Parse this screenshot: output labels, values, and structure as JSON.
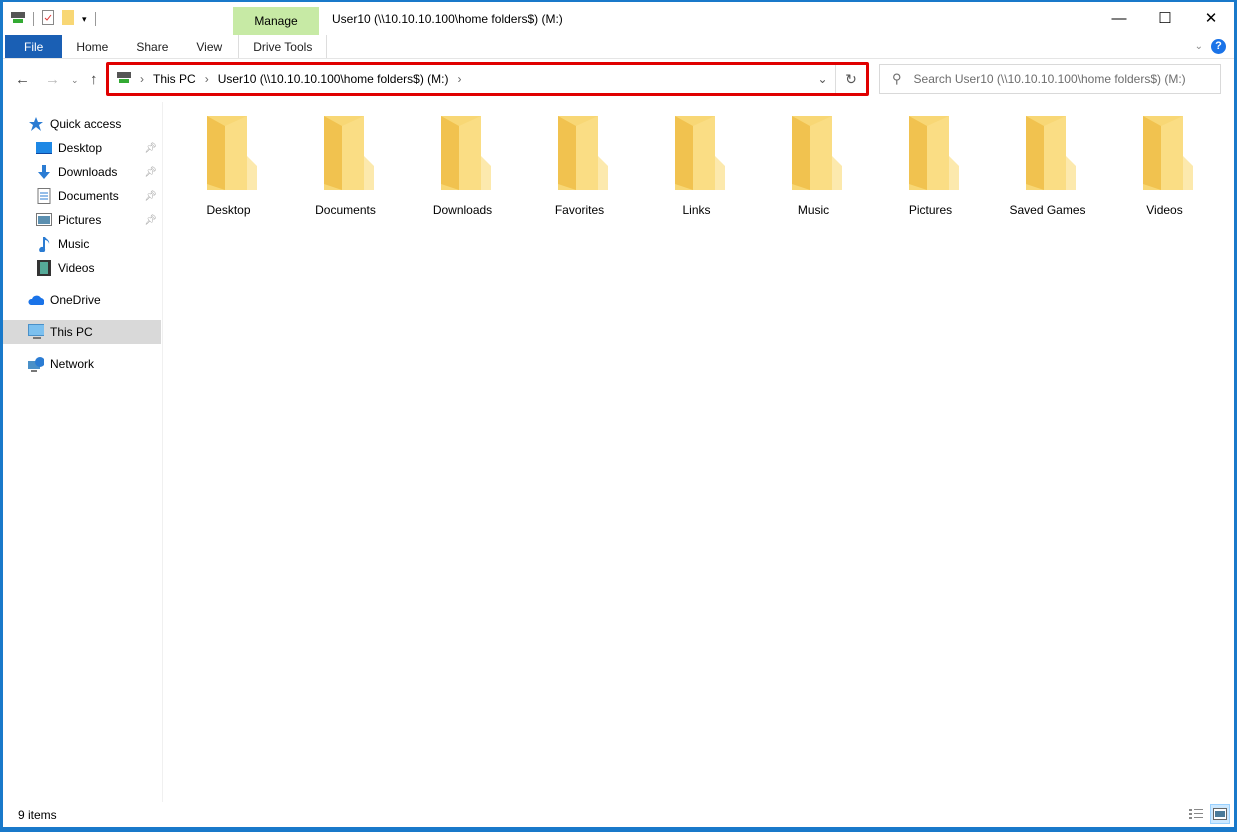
{
  "window": {
    "title": "User10 (\\\\10.10.10.100\\home folders$) (M:)"
  },
  "ribbon": {
    "context_group": "Manage",
    "tabs": [
      {
        "label": "File"
      },
      {
        "label": "Home"
      },
      {
        "label": "Share"
      },
      {
        "label": "View"
      },
      {
        "label": "Drive Tools"
      }
    ]
  },
  "address": {
    "crumbs": [
      "This PC",
      "User10 (\\\\10.10.10.100\\home folders$) (M:)"
    ]
  },
  "search": {
    "placeholder": "Search User10 (\\\\10.10.10.100\\home folders$) (M:)"
  },
  "sidebar": {
    "items": [
      {
        "label": "Quick access",
        "icon": "star-icon"
      },
      {
        "label": "Desktop",
        "icon": "desktop-icon",
        "pinned": true
      },
      {
        "label": "Downloads",
        "icon": "download-icon",
        "pinned": true
      },
      {
        "label": "Documents",
        "icon": "document-icon",
        "pinned": true
      },
      {
        "label": "Pictures",
        "icon": "pictures-icon",
        "pinned": true
      },
      {
        "label": "Music",
        "icon": "music-icon"
      },
      {
        "label": "Videos",
        "icon": "videos-icon"
      },
      {
        "label": "OneDrive",
        "icon": "cloud-icon"
      },
      {
        "label": "This PC",
        "icon": "computer-icon",
        "selected": true
      },
      {
        "label": "Network",
        "icon": "network-icon"
      }
    ]
  },
  "folders": [
    "Desktop",
    "Documents",
    "Downloads",
    "Favorites",
    "Links",
    "Music",
    "Pictures",
    "Saved Games",
    "Videos"
  ],
  "status": {
    "items": "9 items"
  },
  "colors": {
    "accent": "#1979ca",
    "highlight": "#e00000",
    "folder": "#f8d775"
  }
}
